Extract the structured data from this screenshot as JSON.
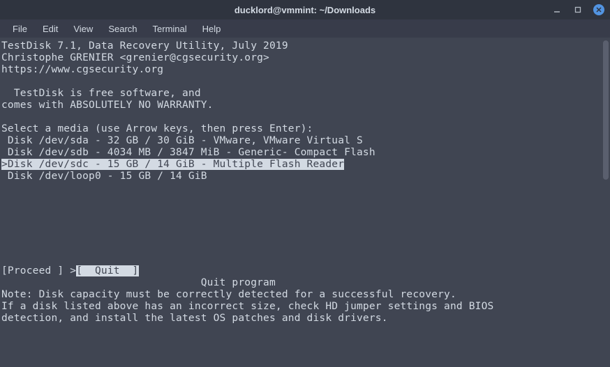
{
  "window": {
    "title": "ducklord@vmmint: ~/Downloads"
  },
  "menu": {
    "file": "File",
    "edit": "Edit",
    "view": "View",
    "search": "Search",
    "terminal": "Terminal",
    "help": "Help"
  },
  "term": {
    "line1": "TestDisk 7.1, Data Recovery Utility, July 2019",
    "line2": "Christophe GRENIER <grenier@cgsecurity.org>",
    "line3": "https://www.cgsecurity.org",
    "line4": "",
    "line5": "  TestDisk is free software, and",
    "line6": "comes with ABSOLUTELY NO WARRANTY.",
    "line7": "",
    "line8": "Select a media (use Arrow keys, then press Enter):",
    "disk1": " Disk /dev/sda - 32 GB / 30 GiB - VMware, VMware Virtual S",
    "disk2": " Disk /dev/sdb - 4034 MB / 3847 MiB - Generic- Compact Flash",
    "disk3_sel": ">Disk /dev/sdc - 15 GB / 14 GiB - Multiple Flash Reader",
    "disk4": " Disk /dev/loop0 - 15 GB / 14 GiB",
    "opt_proceed": "[Proceed ]",
    "opt_marker": " >",
    "opt_quit": "[  Quit  ]",
    "opt_desc": "                                Quit program",
    "note1": "Note: Disk capacity must be correctly detected for a successful recovery.",
    "note2": "If a disk listed above has an incorrect size, check HD jumper settings and BIOS",
    "note3": "detection, and install the latest OS patches and disk drivers."
  }
}
